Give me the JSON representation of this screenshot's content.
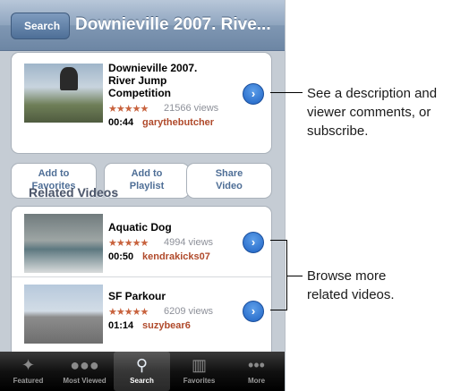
{
  "nav": {
    "back_label": "Search",
    "title": "Downieville 2007. Rive..."
  },
  "video": {
    "title_line1": "Downieville 2007.",
    "title_line2": "River Jump",
    "title_line3": "Competition",
    "stars": "★★★★★",
    "views": "21566 views",
    "duration": "00:44",
    "user": "garythebutcher"
  },
  "actions": [
    {
      "line1": "Add to",
      "line2": "Favorites"
    },
    {
      "line1": "Add to",
      "line2": "Playlist"
    },
    {
      "line1": "Share",
      "line2": "Video"
    }
  ],
  "related": {
    "header": "Related Videos",
    "items": [
      {
        "title": "Aquatic Dog",
        "stars": "★★★★★",
        "views": "4994 views",
        "duration": "00:50",
        "user": "kendrakicks07"
      },
      {
        "title": "SF Parkour",
        "stars": "★★★★★",
        "views": "6209 views",
        "duration": "01:14",
        "user": "suzybear6"
      }
    ]
  },
  "tabs": [
    {
      "label": "Featured",
      "icon": "featured-icon"
    },
    {
      "label": "Most Viewed",
      "icon": "most-viewed-icon"
    },
    {
      "label": "Search",
      "icon": "search-icon"
    },
    {
      "label": "Favorites",
      "icon": "favorites-icon"
    },
    {
      "label": "More",
      "icon": "more-icon"
    }
  ],
  "callouts": {
    "top_line1": "See a description and",
    "top_line2": "viewer comments, or",
    "top_line3": "subscribe.",
    "bottom_line1": "Browse more",
    "bottom_line2": "related videos."
  },
  "colors": {
    "accent_blue": "#1f63c4",
    "user_red": "#b04a2b",
    "star_orange": "#c8623d"
  }
}
